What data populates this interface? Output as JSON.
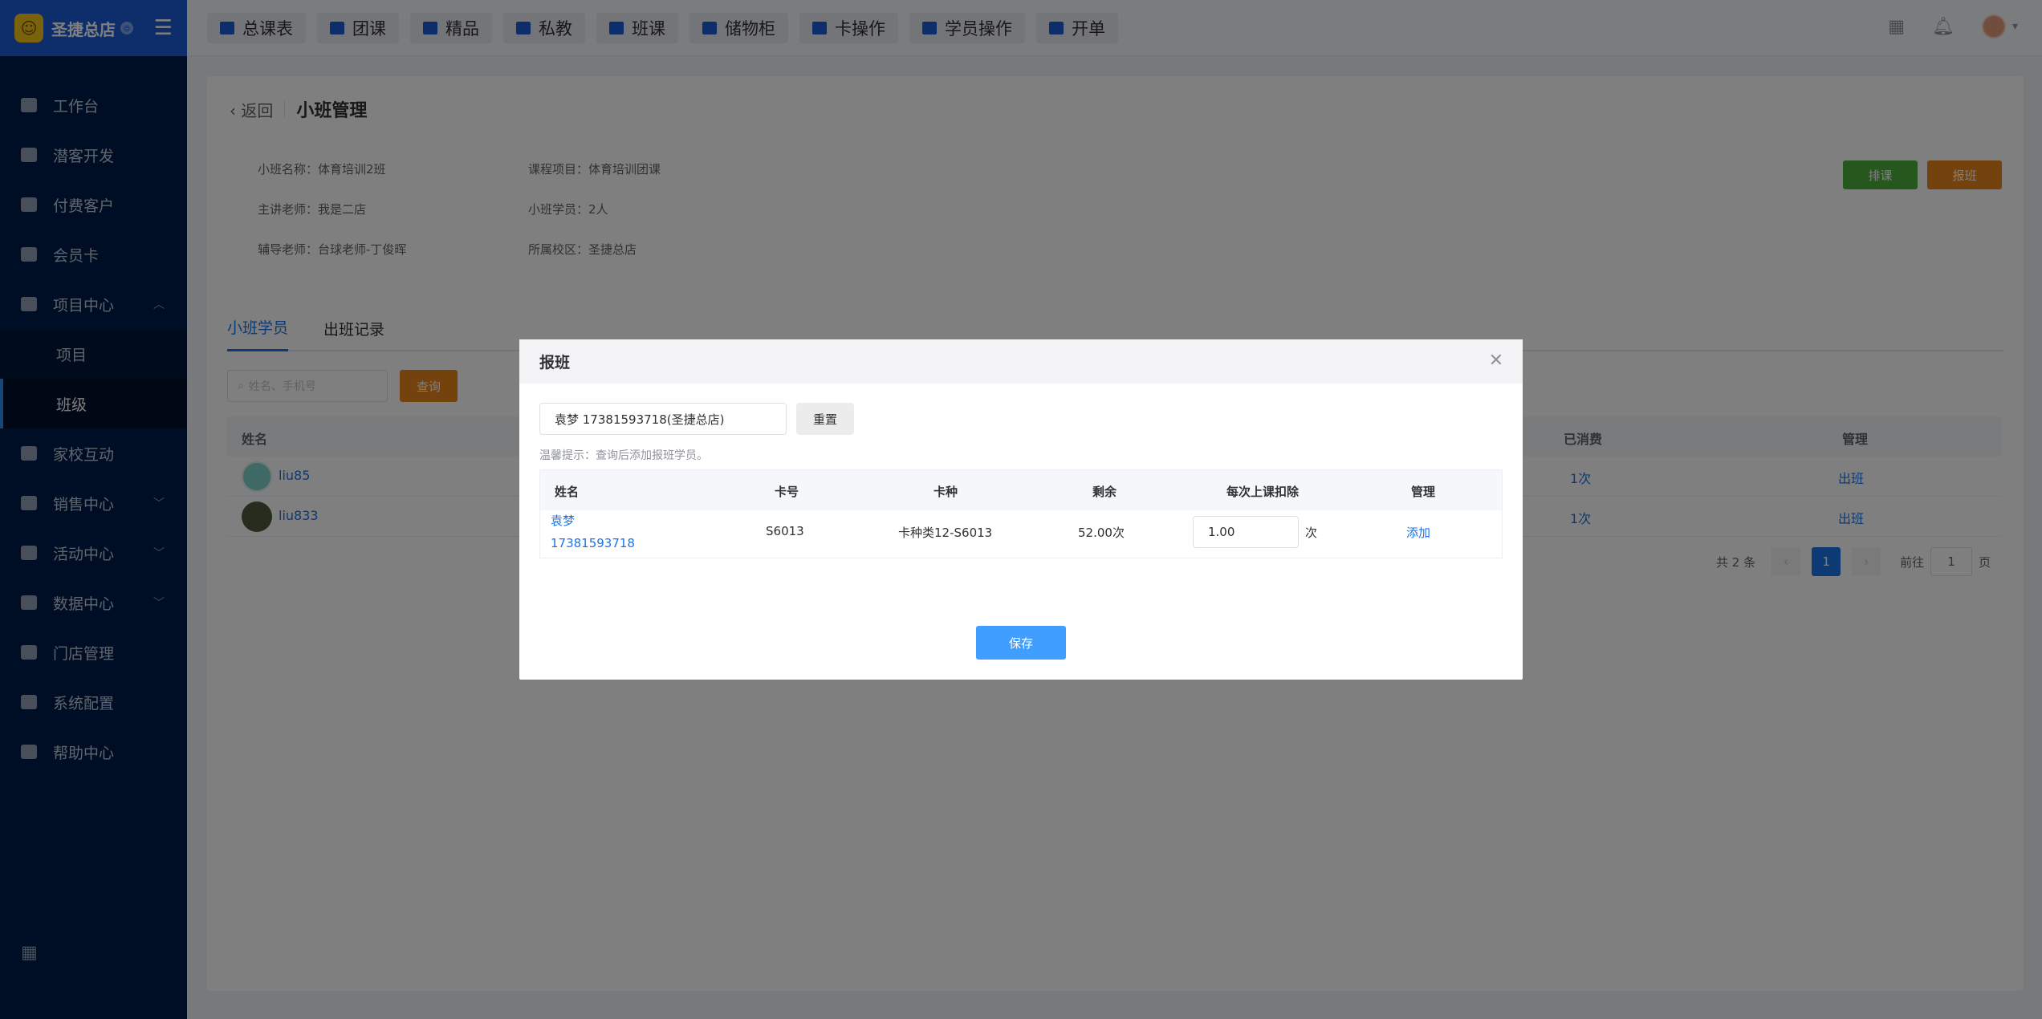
{
  "brand": {
    "name": "圣捷总店",
    "badge": "⊜"
  },
  "sidebar": {
    "items": [
      {
        "label": "工作台"
      },
      {
        "label": "潜客开发"
      },
      {
        "label": "付费客户"
      },
      {
        "label": "会员卡"
      },
      {
        "label": "项目中心",
        "expanded": true
      },
      {
        "label": "家校互动"
      },
      {
        "label": "销售中心"
      },
      {
        "label": "活动中心"
      },
      {
        "label": "数据中心"
      },
      {
        "label": "门店管理"
      },
      {
        "label": "系统配置"
      },
      {
        "label": "帮助中心"
      }
    ],
    "sub_items": [
      {
        "label": "项目"
      },
      {
        "label": "班级"
      }
    ]
  },
  "topbar": {
    "buttons": [
      {
        "label": "总课表"
      },
      {
        "label": "团课"
      },
      {
        "label": "精品"
      },
      {
        "label": "私教"
      },
      {
        "label": "班课"
      },
      {
        "label": "储物柜"
      },
      {
        "label": "卡操作"
      },
      {
        "label": "学员操作"
      },
      {
        "label": "开单"
      }
    ]
  },
  "page": {
    "back": "返回",
    "title": "小班管理",
    "info": {
      "class_name": "小班名称：体育培训2班",
      "course_item": "课程项目：体育培训团课",
      "teacher": "主讲老师：我是二店",
      "students": "小班学员：2人",
      "assistant": "辅导老师：台球老师-丁俊晖",
      "campus": "所属校区：圣捷总店"
    },
    "btn_schedule": "排课",
    "btn_enroll": "报班",
    "tabs": [
      {
        "label": "小班学员"
      },
      {
        "label": "出班记录"
      }
    ],
    "search_placeholder": "姓名、手机号",
    "btn_query": "查询",
    "table_headers": {
      "name": "姓名",
      "consumed": "已消费",
      "manage": "管理"
    },
    "rows": [
      {
        "name": "liu85",
        "consumed": "1次",
        "action": "出班"
      },
      {
        "name": "liu833",
        "consumed": "1次",
        "action": "出班"
      }
    ],
    "pager": {
      "total": "共 2 条",
      "current": "1",
      "goto": "前往",
      "goto_value": "1",
      "page_unit": "页"
    }
  },
  "modal": {
    "title": "报班",
    "search_value": "袁梦 17381593718(圣捷总店)",
    "reset": "重置",
    "tip": "温馨提示：查询后添加报班学员。",
    "headers": {
      "name": "姓名",
      "card_no": "卡号",
      "card_type": "卡种",
      "remaining": "剩余",
      "deduct": "每次上课扣除",
      "manage": "管理"
    },
    "row": {
      "name": "袁梦",
      "phone": "17381593718",
      "card_no": "S6013",
      "card_type": "卡种类12-S6013",
      "remaining": "52.00次",
      "deduct_value": "1.00",
      "deduct_unit": "次",
      "action": "添加"
    },
    "save": "保存"
  }
}
